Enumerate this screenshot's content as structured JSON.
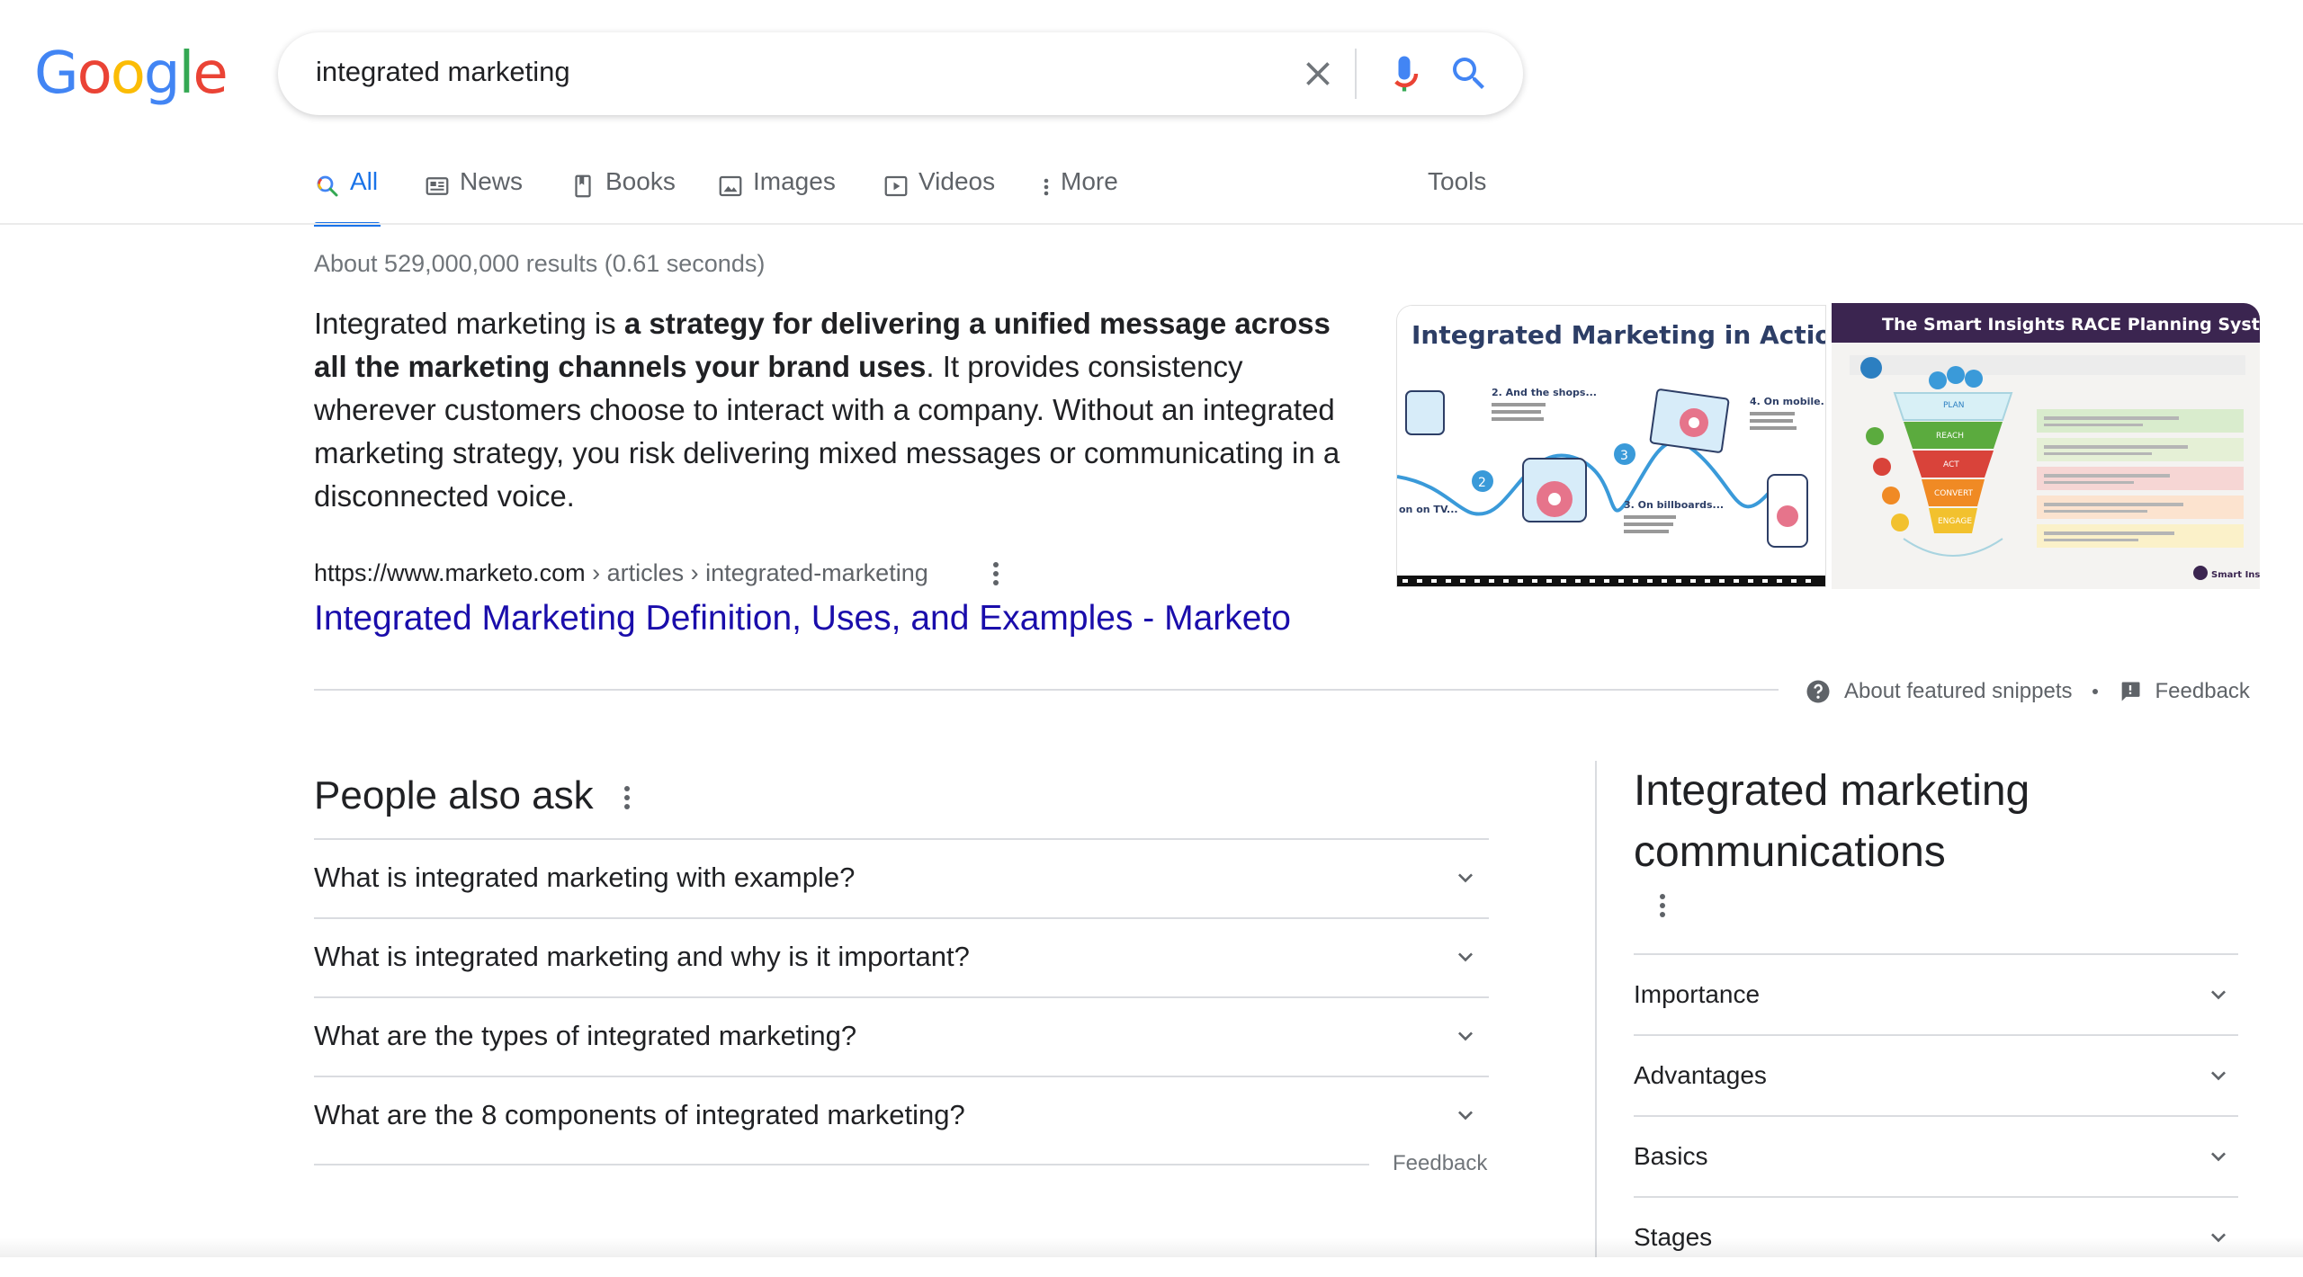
{
  "logo": {
    "letters": [
      "G",
      "o",
      "o",
      "g",
      "l",
      "e"
    ],
    "colors": [
      "#4285f4",
      "#ea4335",
      "#fbbc05",
      "#4285f4",
      "#34a853",
      "#ea4335"
    ]
  },
  "search": {
    "query": "integrated marketing"
  },
  "tabs": [
    {
      "label": "All",
      "icon": "search-icon",
      "active": true
    },
    {
      "label": "News",
      "icon": "news-icon"
    },
    {
      "label": "Books",
      "icon": "book-icon"
    },
    {
      "label": "Images",
      "icon": "image-icon"
    },
    {
      "label": "Videos",
      "icon": "video-icon"
    },
    {
      "label": "More",
      "icon": "more-vert-icon"
    }
  ],
  "tools_label": "Tools",
  "result_stats": "About 529,000,000 results (0.61 seconds)",
  "snippet": {
    "pre": "Integrated marketing is ",
    "bold": "a strategy for delivering a unified message across all the marketing channels your brand uses",
    "post": ". It provides consistency wherever customers choose to interact with a company. Without an integrated marketing strategy, you risk delivering mixed messages or communicating in a disconnected voice."
  },
  "source": {
    "domain": "https://www.marketo.com",
    "path": " › articles › integrated-marketing"
  },
  "result_link": "Integrated Marketing Definition, Uses, and Examples - Marketo",
  "images": [
    {
      "title": "Integrated Marketing in Action",
      "steps": [
        "2. And the shops...",
        "3. On billboards...",
        "4. On mobile.",
        "on on TV..."
      ]
    },
    {
      "title": "The Smart Insights RACE Planning System",
      "stages": [
        "PLAN",
        "REACH",
        "ACT",
        "CONVERT",
        "ENGAGE"
      ],
      "brand": "Smart Insights"
    }
  ],
  "snippet_footer": {
    "about": "About featured snippets",
    "feedback": "Feedback"
  },
  "paa": {
    "title": "People also ask",
    "questions": [
      "What is integrated marketing with example?",
      "What is integrated marketing and why is it important?",
      "What are the types of integrated marketing?",
      "What are the 8 components of integrated marketing?"
    ],
    "feedback": "Feedback"
  },
  "knowledge_panel": {
    "title": "Integrated marketing communications",
    "items": [
      "Importance",
      "Advantages",
      "Basics",
      "Stages"
    ]
  },
  "colors": {
    "accent": "#1a73e8",
    "link": "#1a0dab",
    "text": "#202124",
    "muted": "#5f6368"
  }
}
